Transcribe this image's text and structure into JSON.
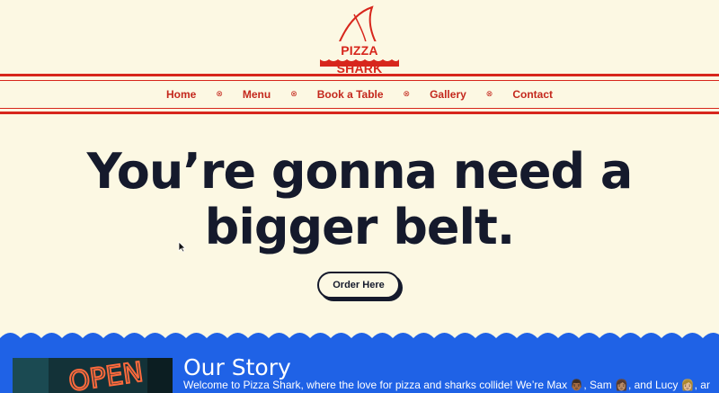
{
  "brand": {
    "logo_text": "PIZZA SHARK"
  },
  "nav": {
    "items": [
      "Home",
      "Menu",
      "Book a Table",
      "Gallery",
      "Contact"
    ],
    "separator": "⊗"
  },
  "hero": {
    "headline": "You’re gonna need a bigger belt.",
    "order_button": "Order Here"
  },
  "story": {
    "title": "Our Story",
    "text": "Welcome to Pizza Shark, where the love for pizza and sharks collide! We’re Max 👨🏾, Sam 👩🏽, and Lucy 👩🏼, and we’re"
  },
  "colors": {
    "background": "#fcf8e3",
    "brand_red": "#d7261c",
    "ink": "#151a2c",
    "story_blue": "#1f62e6"
  }
}
